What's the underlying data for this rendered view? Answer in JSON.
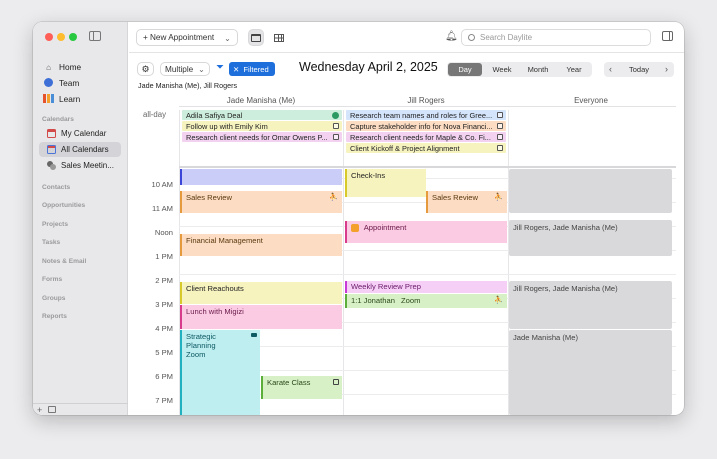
{
  "sidebar": {
    "nav": [
      {
        "label": "Home",
        "icon": "home-icon"
      },
      {
        "label": "Team",
        "icon": "team-icon"
      },
      {
        "label": "Learn",
        "icon": "learn-icon"
      }
    ],
    "calendars_label": "Calendars",
    "calendars": [
      {
        "label": "My Calendar"
      },
      {
        "label": "All Calendars"
      },
      {
        "label": "Sales Meetin..."
      }
    ],
    "sections": [
      "Contacts",
      "Opportunities",
      "Projects",
      "Tasks",
      "Notes & Email",
      "Forms",
      "Groups",
      "Reports"
    ],
    "bottom_plus": "+"
  },
  "toolbar": {
    "new_appointment": "+ New Appointment",
    "dropdown": "⌄",
    "search_placeholder": "Search Daylite",
    "bell": "bell-icon"
  },
  "subbar": {
    "filter_mode": "Multiple",
    "filtered_label": "Filtered",
    "date_title": "Wednesday April 2, 2025",
    "views": [
      "Day",
      "Week",
      "Month",
      "Year"
    ],
    "selected_view": "Day",
    "today": "Today",
    "people": "Jade Manisha (Me), Jill Rogers"
  },
  "columns": [
    "Jade Manisha (Me)",
    "Jill Rogers",
    "Everyone"
  ],
  "allday_label": "all-day",
  "allday_events": {
    "jade": [
      {
        "title": "Adila Safiya Deal",
        "color": "#cdeedd"
      },
      {
        "title": "Follow up with Emily Kim",
        "color": "#f6f3bf"
      },
      {
        "title": "Research client needs for Omar Owens P...",
        "color": "#f3d2f1"
      }
    ],
    "jill": [
      {
        "title": "Research team names and roles for Gree...",
        "color": "#d4e4fb"
      },
      {
        "title": "Capture stakeholder info for Nova Financi...",
        "color": "#fcdcc2"
      },
      {
        "title": "Research client needs for Maple & Co. Fi...",
        "color": "#f3d2f1"
      },
      {
        "title": "Client Kickoff & Project Alignment",
        "color": "#f6f3bf"
      }
    ]
  },
  "hours": [
    "10 AM",
    "11 AM",
    "Noon",
    "1 PM",
    "2 PM",
    "3 PM",
    "4 PM",
    "5 PM",
    "6 PM",
    "7 PM"
  ],
  "events": {
    "jade": [
      {
        "title": "",
        "color": "#c9cdf7"
      },
      {
        "title": "Sales Review",
        "color": "#fcdcc2"
      },
      {
        "title": "Financial Management",
        "color": "#fcdcc2"
      },
      {
        "title": "Client Reachouts",
        "color": "#f6f3bf"
      },
      {
        "title": "Lunch with Migizi",
        "color": "#fbcbe3"
      },
      {
        "title": "Strategic Planning",
        "sub": "Zoom",
        "color": "#bfeef0"
      },
      {
        "title": "Karate Class",
        "color": "#d8f0c6"
      }
    ],
    "jill": [
      {
        "title": "Check-Ins",
        "color": "#f6f3bf"
      },
      {
        "title": "Sales Review",
        "color": "#fcdcc2"
      },
      {
        "title": "Appointment",
        "color": "#fbcbe3"
      },
      {
        "title": "Weekly Review Prep",
        "color": "#f5cff5"
      },
      {
        "title": "1:1 Jonathan",
        "sub": "Zoom",
        "color": "#d8f0c6"
      }
    ],
    "everyone": [
      {
        "title": "",
        "color": "#d9d9db"
      },
      {
        "title": "Jill Rogers, Jade Manisha (Me)"
      },
      {
        "title": "Jill Rogers, Jade Manisha (Me)"
      },
      {
        "title": "Jade Manisha (Me)"
      }
    ]
  }
}
